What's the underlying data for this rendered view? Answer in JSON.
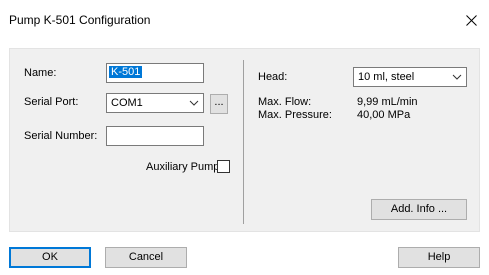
{
  "window": {
    "title": "Pump K-501 Configuration"
  },
  "left": {
    "name_label": "Name:",
    "name_value": "K-501",
    "serial_port_label": "Serial Port:",
    "serial_port_value": "COM1",
    "serial_port_more": "...",
    "serial_number_label": "Serial Number:",
    "serial_number_value": "",
    "auxiliary_label": "Auxiliary Pump",
    "auxiliary_checked": false
  },
  "right": {
    "head_label": "Head:",
    "head_value": "10 ml, steel",
    "max_flow_label": "Max. Flow:",
    "max_flow_value": "9,99 mL/min",
    "max_pressure_label": "Max. Pressure:",
    "max_pressure_value": "40,00 MPa",
    "add_info_label": "Add. Info ..."
  },
  "footer": {
    "ok_label": "OK",
    "cancel_label": "Cancel",
    "help_label": "Help"
  },
  "icons": {
    "close": "close-icon",
    "dropdown": "chevron-down-icon"
  },
  "colors": {
    "selection": "#0078d7",
    "panel": "#f0f0f0"
  }
}
